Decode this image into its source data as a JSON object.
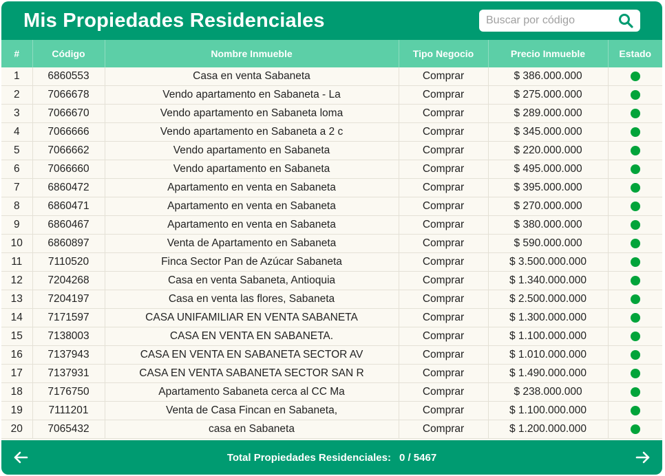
{
  "header": {
    "title": "Mis Propiedades Residenciales",
    "search_placeholder": "Buscar por código"
  },
  "table": {
    "columns": [
      "#",
      "Código",
      "Nombre Inmueble",
      "Tipo Negocio",
      "Precio Inmueble",
      "Estado"
    ],
    "rows": [
      {
        "num": "1",
        "code": "6860553",
        "name": "Casa en venta Sabaneta",
        "type": "Comprar",
        "price": "$ 386.000.000",
        "status": "active"
      },
      {
        "num": "2",
        "code": "7066678",
        "name": "Vendo apartamento en Sabaneta - La",
        "type": "Comprar",
        "price": "$ 275.000.000",
        "status": "active"
      },
      {
        "num": "3",
        "code": "7066670",
        "name": "Vendo apartamento en Sabaneta loma",
        "type": "Comprar",
        "price": "$ 289.000.000",
        "status": "active"
      },
      {
        "num": "4",
        "code": "7066666",
        "name": "Vendo apartamento en Sabaneta a 2 c",
        "type": "Comprar",
        "price": "$ 345.000.000",
        "status": "active"
      },
      {
        "num": "5",
        "code": "7066662",
        "name": "Vendo apartamento en Sabaneta",
        "type": "Comprar",
        "price": "$ 220.000.000",
        "status": "active"
      },
      {
        "num": "6",
        "code": "7066660",
        "name": "Vendo apartamento en Sabaneta",
        "type": "Comprar",
        "price": "$ 495.000.000",
        "status": "active"
      },
      {
        "num": "7",
        "code": "6860472",
        "name": "Apartamento en venta en Sabaneta",
        "type": "Comprar",
        "price": "$ 395.000.000",
        "status": "active"
      },
      {
        "num": "8",
        "code": "6860471",
        "name": "Apartamento en venta en Sabaneta",
        "type": "Comprar",
        "price": "$ 270.000.000",
        "status": "active"
      },
      {
        "num": "9",
        "code": "6860467",
        "name": "Apartamento en venta en Sabaneta",
        "type": "Comprar",
        "price": "$ 380.000.000",
        "status": "active"
      },
      {
        "num": "10",
        "code": "6860897",
        "name": "Venta de Apartamento en Sabaneta",
        "type": "Comprar",
        "price": "$ 590.000.000",
        "status": "active"
      },
      {
        "num": "11",
        "code": "7110520",
        "name": "Finca Sector Pan de Azúcar Sabaneta",
        "type": "Comprar",
        "price": "$ 3.500.000.000",
        "status": "active"
      },
      {
        "num": "12",
        "code": "7204268",
        "name": "Casa en venta Sabaneta, Antioquia",
        "type": "Comprar",
        "price": "$ 1.340.000.000",
        "status": "active"
      },
      {
        "num": "13",
        "code": "7204197",
        "name": "Casa en venta las flores, Sabaneta",
        "type": "Comprar",
        "price": "$ 2.500.000.000",
        "status": "active"
      },
      {
        "num": "14",
        "code": "7171597",
        "name": "CASA UNIFAMILIAR EN VENTA SABANETA",
        "type": "Comprar",
        "price": "$ 1.300.000.000",
        "status": "active"
      },
      {
        "num": "15",
        "code": "7138003",
        "name": "CASA EN VENTA EN SABANETA.",
        "type": "Comprar",
        "price": "$ 1.100.000.000",
        "status": "active"
      },
      {
        "num": "16",
        "code": "7137943",
        "name": "CASA EN VENTA EN SABANETA SECTOR AV",
        "type": "Comprar",
        "price": "$ 1.010.000.000",
        "status": "active"
      },
      {
        "num": "17",
        "code": "7137931",
        "name": "CASA EN VENTA SABANETA SECTOR SAN R",
        "type": "Comprar",
        "price": "$ 1.490.000.000",
        "status": "active"
      },
      {
        "num": "18",
        "code": "7176750",
        "name": "Apartamento Sabaneta cerca al CC Ma",
        "type": "Comprar",
        "price": "$ 238.000.000",
        "status": "active"
      },
      {
        "num": "19",
        "code": "7111201",
        "name": "Venta de  Casa Fincan en Sabaneta,",
        "type": "Comprar",
        "price": "$ 1.100.000.000",
        "status": "active"
      },
      {
        "num": "20",
        "code": "7065432",
        "name": "casa en Sabaneta",
        "type": "Comprar",
        "price": "$ 1.200.000.000",
        "status": "active"
      }
    ]
  },
  "footer": {
    "total_label": "Total Propiedades Residenciales:",
    "total_value": "0 / 5467",
    "prev_icon": "arrow-left-icon",
    "next_icon": "arrow-right-icon"
  },
  "colors": {
    "primary": "#009b71",
    "header_row": "#5ccfa7",
    "row_bg": "#fbf9f2",
    "status_active": "#02a43a"
  }
}
